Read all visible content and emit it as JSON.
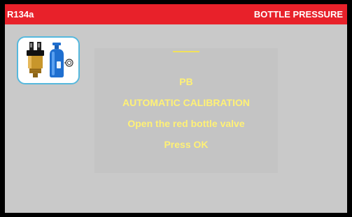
{
  "header": {
    "refrigerant": "R134a",
    "title": "BOTTLE PRESSURE"
  },
  "icon": {
    "name": "pressure-sensor-and-bottle-icon"
  },
  "message": {
    "line1": "PB",
    "line2": "AUTOMATIC CALIBRATION",
    "line3": "Open the red bottle valve",
    "line4": "Press OK"
  },
  "colors": {
    "header_bg": "#e8212a",
    "header_text": "#ffffff",
    "screen_bg": "#c9c9c9",
    "message_text": "#fff176",
    "icon_border": "#55b8dd",
    "bottle": "#1f6fd0",
    "sensor_body": "#c8962b"
  }
}
